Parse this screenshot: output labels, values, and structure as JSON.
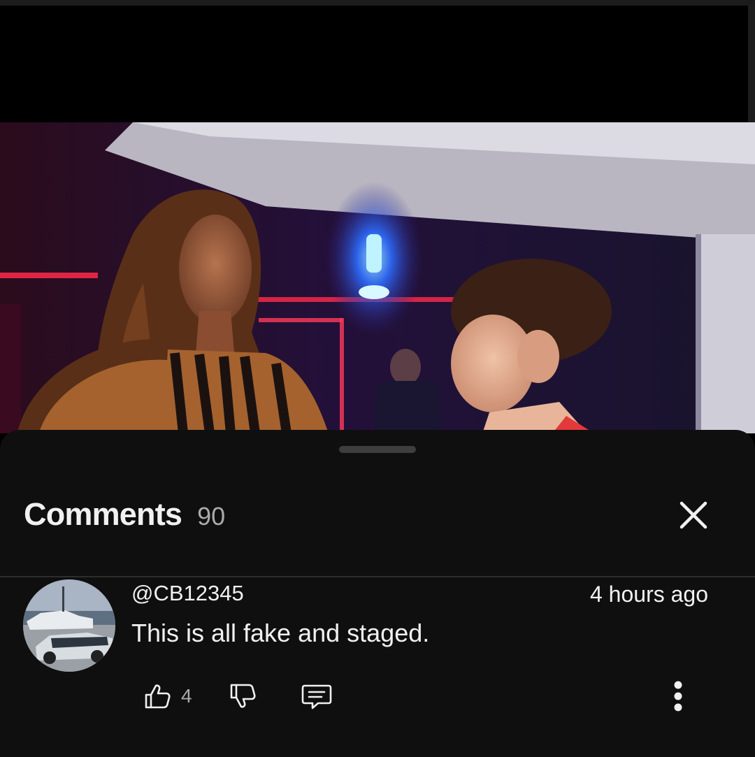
{
  "video": {
    "frame_name": "video-frame"
  },
  "comments_panel": {
    "title": "Comments",
    "count": "90",
    "close_icon": "close-icon"
  },
  "comments": [
    {
      "author": "@CB12345",
      "time": "4 hours ago",
      "text": "This is all fake and staged.",
      "likes": "4",
      "icons": {
        "like": "thumbs-up-icon",
        "dislike": "thumbs-down-icon",
        "reply": "reply-icon",
        "more": "more-vertical-icon"
      }
    }
  ],
  "colors": {
    "background": "#0f0f0f",
    "text_primary": "#f1f1f1",
    "text_secondary": "#aaaaaa",
    "divider": "#2d2d2d"
  }
}
